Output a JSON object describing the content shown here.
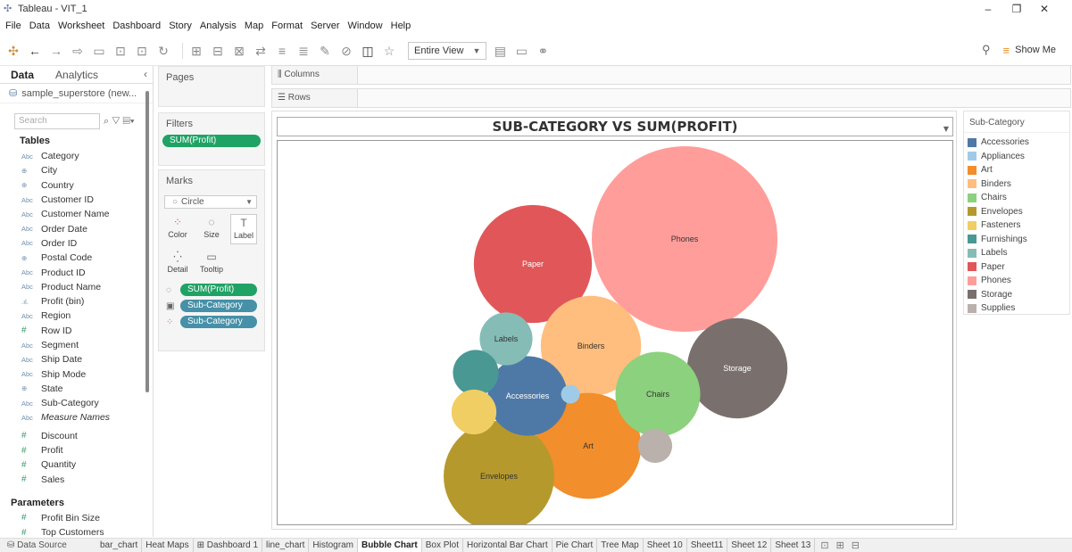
{
  "window": {
    "title": "Tableau - VIT_1",
    "minimize": "–",
    "restore": "❐",
    "close": "✕"
  },
  "menu": [
    "File",
    "Data",
    "Worksheet",
    "Dashboard",
    "Story",
    "Analysis",
    "Map",
    "Format",
    "Server",
    "Window",
    "Help"
  ],
  "toolbar": {
    "view_select": "Entire View",
    "show_me": "Show Me"
  },
  "data_pane": {
    "tabs": {
      "data": "Data",
      "analytics": "Analytics"
    },
    "datasource": "sample_superstore (new...",
    "search_placeholder": "Search",
    "tables_title": "Tables",
    "fields": [
      {
        "type": "Abc",
        "name": "Category"
      },
      {
        "type": "geo",
        "name": "City"
      },
      {
        "type": "geo",
        "name": "Country"
      },
      {
        "type": "Abc",
        "name": "Customer ID"
      },
      {
        "type": "Abc",
        "name": "Customer Name"
      },
      {
        "type": "Abc",
        "name": "Order Date"
      },
      {
        "type": "Abc",
        "name": "Order ID"
      },
      {
        "type": "geo",
        "name": "Postal Code"
      },
      {
        "type": "Abc",
        "name": "Product ID"
      },
      {
        "type": "Abc",
        "name": "Product Name"
      },
      {
        "type": "bin",
        "name": "Profit (bin)"
      },
      {
        "type": "Abc",
        "name": "Region"
      },
      {
        "type": "#",
        "name": "Row ID"
      },
      {
        "type": "Abc",
        "name": "Segment"
      },
      {
        "type": "Abc",
        "name": "Ship Date"
      },
      {
        "type": "Abc",
        "name": "Ship Mode"
      },
      {
        "type": "geo",
        "name": "State"
      },
      {
        "type": "Abc",
        "name": "Sub-Category"
      },
      {
        "type": "Abc",
        "name": "Measure Names",
        "italic": true
      }
    ],
    "measures": [
      {
        "type": "#",
        "name": "Discount"
      },
      {
        "type": "#",
        "name": "Profit"
      },
      {
        "type": "#",
        "name": "Quantity"
      },
      {
        "type": "#",
        "name": "Sales"
      }
    ],
    "parameters_title": "Parameters",
    "parameters": [
      {
        "type": "#",
        "name": "Profit Bin Size"
      },
      {
        "type": "#",
        "name": "Top Customers"
      }
    ]
  },
  "cards": {
    "pages": "Pages",
    "filters": "Filters",
    "filter_pill": "SUM(Profit)",
    "marks": "Marks",
    "mark_type": "Circle",
    "mark_buttons": [
      "Color",
      "Size",
      "Label",
      "Detail",
      "Tooltip"
    ],
    "mark_pills": [
      "SUM(Profit)",
      "Sub-Category",
      "Sub-Category"
    ]
  },
  "shelves": {
    "columns": "Columns",
    "rows": "Rows"
  },
  "chart_data": {
    "type": "bubble",
    "title": "SUB-CATEGORY VS SUM(PROFIT)",
    "size_measure": "SUM(Profit)",
    "color_dimension": "Sub-Category",
    "bubbles": [
      {
        "name": "Phones",
        "value": 44516,
        "color": "#ff9d9a",
        "label": "Phones"
      },
      {
        "name": "Paper",
        "value": 18000,
        "color": "#e15759",
        "label": "Paper"
      },
      {
        "name": "Storage",
        "value": 13000,
        "color": "#79706e",
        "label": "Storage"
      },
      {
        "name": "Binders",
        "value": 13000,
        "color": "#ffbe7d",
        "label": "Binders"
      },
      {
        "name": "Art",
        "value": 14500,
        "color": "#f28e2b",
        "label": "Art"
      },
      {
        "name": "Envelopes",
        "value": 15800,
        "color": "#b6992d",
        "label": "Envelopes"
      },
      {
        "name": "Accessories",
        "value": 8200,
        "color": "#4e79a7",
        "label": "Accessories"
      },
      {
        "name": "Chairs",
        "value": 9300,
        "color": "#8cd17d",
        "label": "Chairs"
      },
      {
        "name": "Labels",
        "value": 3600,
        "color": "#86bcb6",
        "label": "Labels"
      },
      {
        "name": "Furnishings",
        "value": 2700,
        "color": "#499894",
        "label": ""
      },
      {
        "name": "Fasteners",
        "value": 2600,
        "color": "#f1ce63",
        "label": ""
      },
      {
        "name": "Supplies",
        "value": 1500,
        "color": "#bab0ac",
        "label": ""
      },
      {
        "name": "Appliances",
        "value": 450,
        "color": "#a0cbe8",
        "label": ""
      }
    ]
  },
  "legend": {
    "title": "Sub-Category",
    "items": [
      {
        "name": "Accessories",
        "color": "#4e79a7"
      },
      {
        "name": "Appliances",
        "color": "#a0cbe8"
      },
      {
        "name": "Art",
        "color": "#f28e2b"
      },
      {
        "name": "Binders",
        "color": "#ffbe7d"
      },
      {
        "name": "Chairs",
        "color": "#8cd17d"
      },
      {
        "name": "Envelopes",
        "color": "#b6992d"
      },
      {
        "name": "Fasteners",
        "color": "#f1ce63"
      },
      {
        "name": "Furnishings",
        "color": "#499894"
      },
      {
        "name": "Labels",
        "color": "#86bcb6"
      },
      {
        "name": "Paper",
        "color": "#e15759"
      },
      {
        "name": "Phones",
        "color": "#ff9d9a"
      },
      {
        "name": "Storage",
        "color": "#79706e"
      },
      {
        "name": "Supplies",
        "color": "#bab0ac"
      }
    ]
  },
  "bottom_tabs": {
    "datasource": "Data Source",
    "sheets": [
      "bar_chart",
      "Heat Maps",
      "Dashboard 1",
      "line_chart",
      "Histogram",
      "Bubble Chart",
      "Box Plot",
      "Horizontal Bar Chart",
      "Pie Chart",
      "Tree Map",
      "Sheet 10",
      "Sheet11",
      "Sheet 12",
      "Sheet 13"
    ],
    "active": "Bubble Chart"
  }
}
